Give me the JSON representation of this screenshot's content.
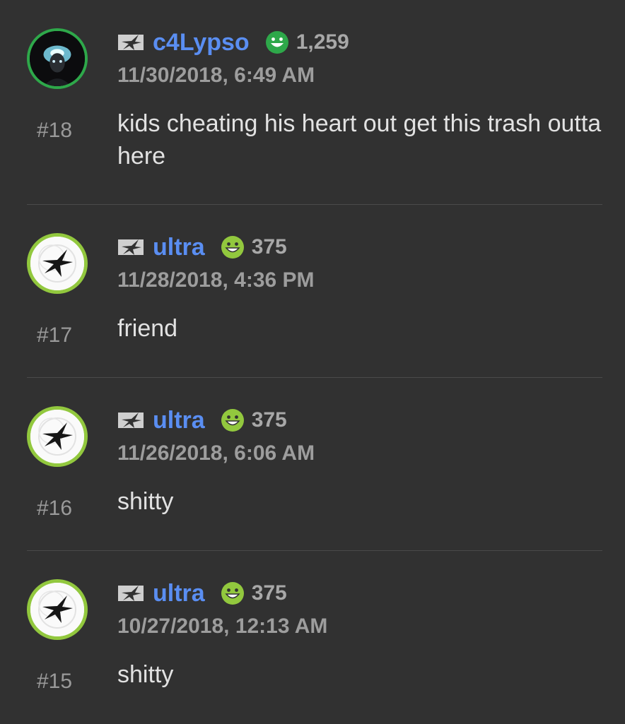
{
  "comments": [
    {
      "id": "c18",
      "number": "#18",
      "username": "c4Lypso",
      "reputation": "1,259",
      "rep_icon": "smiley-green-icon",
      "rep_color": "#2ea84a",
      "date": "11/30/2018, 6:49 AM",
      "text": "kids cheating his heart out get this trash outta here",
      "avatar": "portrait-avatar"
    },
    {
      "id": "c17",
      "number": "#17",
      "username": "ultra",
      "reputation": "375",
      "rep_icon": "smiley-lime-icon",
      "rep_color": "#92c83e",
      "date": "11/28/2018, 4:36 PM",
      "text": "friend",
      "avatar": "star-logo-avatar"
    },
    {
      "id": "c16",
      "number": "#16",
      "username": "ultra",
      "reputation": "375",
      "rep_icon": "smiley-lime-icon",
      "rep_color": "#92c83e",
      "date": "11/26/2018, 6:06 AM",
      "text": "shitty",
      "avatar": "star-logo-avatar"
    },
    {
      "id": "c15",
      "number": "#15",
      "username": "ultra",
      "reputation": "375",
      "rep_icon": "smiley-lime-icon",
      "rep_color": "#92c83e",
      "date": "10/27/2018, 12:13 AM",
      "text": "shitty",
      "avatar": "star-logo-avatar"
    }
  ],
  "colors": {
    "background": "#313131",
    "username": "#5a8ef2",
    "green_ring": "#2ea84a",
    "lime_ring": "#92c83e"
  }
}
